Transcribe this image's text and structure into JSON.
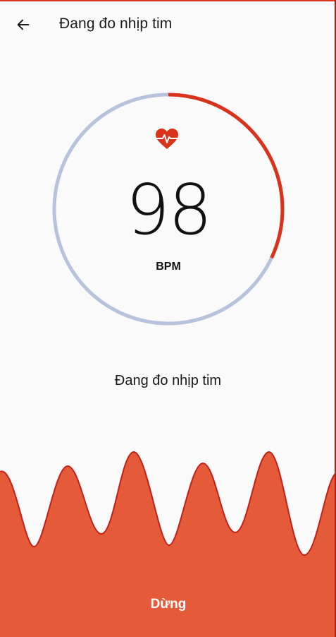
{
  "header": {
    "title": "Đang đo nhịp tim",
    "back_icon": "arrow-left-icon"
  },
  "measurement": {
    "value": "98",
    "unit": "BPM",
    "progress": 0.32,
    "icon": "heart-pulse-icon"
  },
  "status": {
    "text": "Đang đo nhịp tim"
  },
  "actions": {
    "stop_label": "Dừng"
  },
  "colors": {
    "accent": "#d9331c",
    "ring_track": "#b7c2dd",
    "wave_fill": "#e55a38",
    "wave_stroke": "#c2201a",
    "background": "#fafafa"
  }
}
